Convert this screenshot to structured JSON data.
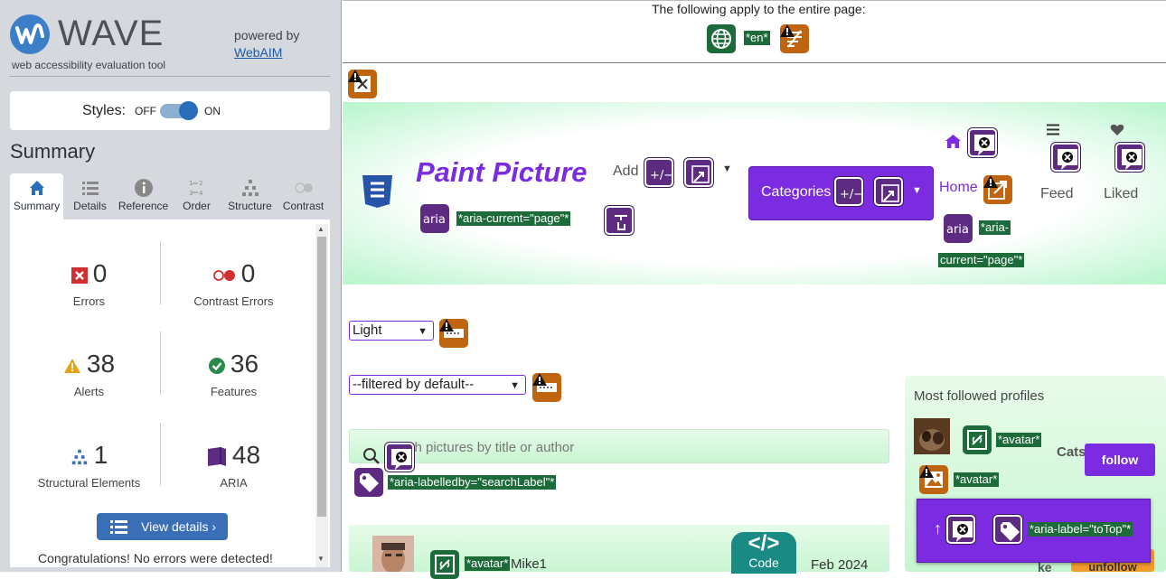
{
  "wave": {
    "logo_word": "WAVE",
    "tagline": "web accessibility evaluation tool",
    "powered_by": "powered by",
    "webaim_link": "WebAIM",
    "styles_label": "Styles:",
    "styles_off": "OFF",
    "styles_on": "ON",
    "summary_heading": "Summary",
    "tabs": [
      {
        "label": "Summary",
        "icon": "home-icon",
        "active": true
      },
      {
        "label": "Details",
        "icon": "list-icon"
      },
      {
        "label": "Reference",
        "icon": "info-icon"
      },
      {
        "label": "Order",
        "icon": "order-icon"
      },
      {
        "label": "Structure",
        "icon": "structure-icon"
      },
      {
        "label": "Contrast",
        "icon": "contrast-icon"
      }
    ],
    "stats": {
      "errors": {
        "value": "0",
        "label": "Errors"
      },
      "contrast_errors": {
        "value": "0",
        "label": "Contrast Errors"
      },
      "alerts": {
        "value": "38",
        "label": "Alerts"
      },
      "features": {
        "value": "36",
        "label": "Features"
      },
      "structural": {
        "value": "1",
        "label": "Structural Elements"
      },
      "aria": {
        "value": "48",
        "label": "ARIA"
      }
    },
    "view_details": "View details ›",
    "congrats": "Congratulations! No errors were detected!",
    "colors": {
      "error": "#d0302f",
      "alert": "#e8a317",
      "feature": "#2a8a4a",
      "aria": "#5e2b83",
      "accent": "#3a6fb6"
    }
  },
  "page": {
    "entire_page_note": "The following apply to the entire page:",
    "lang_tag": "*en*",
    "site_title": "Paint Picture",
    "add_label": "Add",
    "categories_label": "Categories",
    "home_link": "Home",
    "feed_label": "Feed",
    "liked_label": "Liked",
    "aria_current_tag": "*aria-current=\"page\"*",
    "aria_current_tag_part1": "*aria-",
    "aria_current_tag_part2": "current=\"page\"*",
    "aria_icon_label": "aria",
    "theme_select": "Light",
    "filter_select": "--filtered by default--",
    "search_placeholder": "ch pictures by title or author",
    "search_label_tag": "*aria-labelledby=\"searchLabel\"*",
    "avatar_tag": "*avatar*",
    "post_author": "Mike1",
    "post_date": "Feb 2024",
    "code_label": "Code",
    "code_glyph": "</>",
    "profiles_heading": "Most followed profiles",
    "profile_name": "Cats",
    "follow_label": "follow",
    "unfollow_label": "unfollow",
    "profile2_fragment": "ke",
    "totop_tag": "*aria-label=\"toTop\"*",
    "totop_arrow": "↑",
    "colors": {
      "brand": "#7b2be0",
      "wave_aria": "#5e2b83",
      "wave_feature": "#1d6b3a",
      "wave_alert": "#c0650f"
    }
  }
}
